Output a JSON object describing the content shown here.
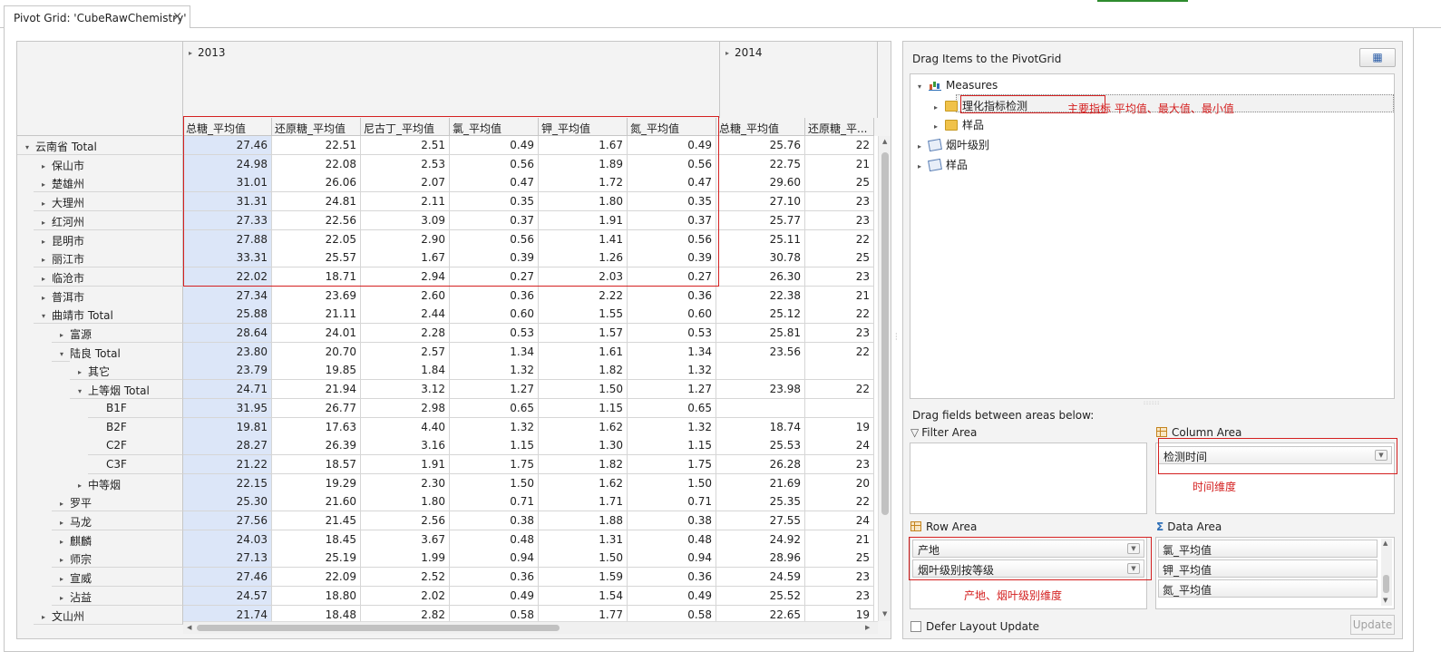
{
  "tab": {
    "title": "Pivot Grid: 'CubeRawChemistry'",
    "close": "×"
  },
  "grid": {
    "years": [
      "2013",
      "2014"
    ],
    "measures": [
      "总糖_平均值",
      "还原糖_平均值",
      "尼古丁_平均值",
      "氯_平均值",
      "钾_平均值",
      "氮_平均值",
      "总糖_平均值",
      "还原糖_平..."
    ],
    "rows": [
      {
        "label": "云南省 Total",
        "level": 0,
        "expander": "▾",
        "values": [
          "27.46",
          "22.51",
          "2.51",
          "0.49",
          "1.67",
          "0.49",
          "25.76",
          "22"
        ]
      },
      {
        "label": "保山市",
        "level": 1,
        "expander": "▸",
        "values": [
          "24.98",
          "22.08",
          "2.53",
          "0.56",
          "1.89",
          "0.56",
          "22.75",
          "21"
        ]
      },
      {
        "label": "楚雄州",
        "level": 1,
        "expander": "▸",
        "values": [
          "31.01",
          "26.06",
          "2.07",
          "0.47",
          "1.72",
          "0.47",
          "29.60",
          "25"
        ]
      },
      {
        "label": "大理州",
        "level": 1,
        "expander": "▸",
        "values": [
          "31.31",
          "24.81",
          "2.11",
          "0.35",
          "1.80",
          "0.35",
          "27.10",
          "23"
        ]
      },
      {
        "label": "红河州",
        "level": 1,
        "expander": "▸",
        "values": [
          "27.33",
          "22.56",
          "3.09",
          "0.37",
          "1.91",
          "0.37",
          "25.77",
          "23"
        ]
      },
      {
        "label": "昆明市",
        "level": 1,
        "expander": "▸",
        "values": [
          "27.88",
          "22.05",
          "2.90",
          "0.56",
          "1.41",
          "0.56",
          "25.11",
          "22"
        ]
      },
      {
        "label": "丽江市",
        "level": 1,
        "expander": "▸",
        "values": [
          "33.31",
          "25.57",
          "1.67",
          "0.39",
          "1.26",
          "0.39",
          "30.78",
          "25"
        ]
      },
      {
        "label": "临沧市",
        "level": 1,
        "expander": "▸",
        "values": [
          "22.02",
          "18.71",
          "2.94",
          "0.27",
          "2.03",
          "0.27",
          "26.30",
          "23"
        ]
      },
      {
        "label": "普洱市",
        "level": 1,
        "expander": "▸",
        "values": [
          "27.34",
          "23.69",
          "2.60",
          "0.36",
          "2.22",
          "0.36",
          "22.38",
          "21"
        ]
      },
      {
        "label": "曲靖市 Total",
        "level": 1,
        "expander": "▾",
        "values": [
          "25.88",
          "21.11",
          "2.44",
          "0.60",
          "1.55",
          "0.60",
          "25.12",
          "22"
        ]
      },
      {
        "label": "富源",
        "level": 2,
        "expander": "▸",
        "values": [
          "28.64",
          "24.01",
          "2.28",
          "0.53",
          "1.57",
          "0.53",
          "25.81",
          "23"
        ]
      },
      {
        "label": "陆良 Total",
        "level": 2,
        "expander": "▾",
        "values": [
          "23.80",
          "20.70",
          "2.57",
          "1.34",
          "1.61",
          "1.34",
          "23.56",
          "22"
        ]
      },
      {
        "label": "其它",
        "level": 3,
        "expander": "▸",
        "values": [
          "23.79",
          "19.85",
          "1.84",
          "1.32",
          "1.82",
          "1.32",
          "",
          ""
        ]
      },
      {
        "label": "上等烟 Total",
        "level": 3,
        "expander": "▾",
        "values": [
          "24.71",
          "21.94",
          "3.12",
          "1.27",
          "1.50",
          "1.27",
          "23.98",
          "22"
        ]
      },
      {
        "label": "B1F",
        "level": 4,
        "expander": "",
        "values": [
          "31.95",
          "26.77",
          "2.98",
          "0.65",
          "1.15",
          "0.65",
          "",
          ""
        ]
      },
      {
        "label": "B2F",
        "level": 4,
        "expander": "",
        "values": [
          "19.81",
          "17.63",
          "4.40",
          "1.32",
          "1.62",
          "1.32",
          "18.74",
          "19"
        ]
      },
      {
        "label": "C2F",
        "level": 4,
        "expander": "",
        "values": [
          "28.27",
          "26.39",
          "3.16",
          "1.15",
          "1.30",
          "1.15",
          "25.53",
          "24"
        ]
      },
      {
        "label": "C3F",
        "level": 4,
        "expander": "",
        "values": [
          "21.22",
          "18.57",
          "1.91",
          "1.75",
          "1.82",
          "1.75",
          "26.28",
          "23"
        ]
      },
      {
        "label": "中等烟",
        "level": 3,
        "expander": "▸",
        "values": [
          "22.15",
          "19.29",
          "2.30",
          "1.50",
          "1.62",
          "1.50",
          "21.69",
          "20"
        ]
      },
      {
        "label": "罗平",
        "level": 2,
        "expander": "▸",
        "values": [
          "25.30",
          "21.60",
          "1.80",
          "0.71",
          "1.71",
          "0.71",
          "25.35",
          "22"
        ]
      },
      {
        "label": "马龙",
        "level": 2,
        "expander": "▸",
        "values": [
          "27.56",
          "21.45",
          "2.56",
          "0.38",
          "1.88",
          "0.38",
          "27.55",
          "24"
        ]
      },
      {
        "label": "麒麟",
        "level": 2,
        "expander": "▸",
        "values": [
          "24.03",
          "18.45",
          "3.67",
          "0.48",
          "1.31",
          "0.48",
          "24.92",
          "21"
        ]
      },
      {
        "label": "师宗",
        "level": 2,
        "expander": "▸",
        "values": [
          "27.13",
          "25.19",
          "1.99",
          "0.94",
          "1.50",
          "0.94",
          "28.96",
          "25"
        ]
      },
      {
        "label": "宣威",
        "level": 2,
        "expander": "▸",
        "values": [
          "27.46",
          "22.09",
          "2.52",
          "0.36",
          "1.59",
          "0.36",
          "24.59",
          "23"
        ]
      },
      {
        "label": "沾益",
        "level": 2,
        "expander": "▸",
        "values": [
          "24.57",
          "18.80",
          "2.02",
          "0.49",
          "1.54",
          "0.49",
          "25.52",
          "23"
        ]
      },
      {
        "label": "文山州",
        "level": 1,
        "expander": "▸",
        "values": [
          "21.74",
          "18.48",
          "2.82",
          "0.58",
          "1.77",
          "0.58",
          "22.65",
          "19"
        ]
      }
    ]
  },
  "fieldlist": {
    "title": "Drag Items to the PivotGrid",
    "tree": [
      {
        "label": "Measures",
        "icon": "measures-icon",
        "expander": "▾"
      },
      {
        "label": "理化指标检测",
        "icon": "folder-icon",
        "expander": "▸"
      },
      {
        "label": "样品",
        "icon": "folder-icon",
        "expander": "▸"
      },
      {
        "label": "烟叶级别",
        "icon": "dimension-icon",
        "expander": "▸"
      },
      {
        "label": "样品",
        "icon": "dimension-icon",
        "expander": "▸"
      }
    ],
    "tree_note": "主要指标  平均值、最大值、最小值",
    "areas_label": "Drag fields between areas below:",
    "filter_area": {
      "title": "Filter Area"
    },
    "column_area": {
      "title": "Column Area",
      "fields": [
        "检测时间"
      ],
      "note": "时间维度"
    },
    "row_area": {
      "title": "Row Area",
      "fields": [
        "产地",
        "烟叶级别按等级"
      ],
      "note": "产地、烟叶级别维度"
    },
    "data_area": {
      "title": "Data Area",
      "fields": [
        "氯_平均值",
        "钾_平均值",
        "氮_平均值"
      ]
    },
    "defer_label": "Defer Layout Update",
    "update_label": "Update"
  },
  "colors": {
    "highlight": "#d42020",
    "first_column": "#dce6f8",
    "header_bg": "#f3f3f3"
  }
}
